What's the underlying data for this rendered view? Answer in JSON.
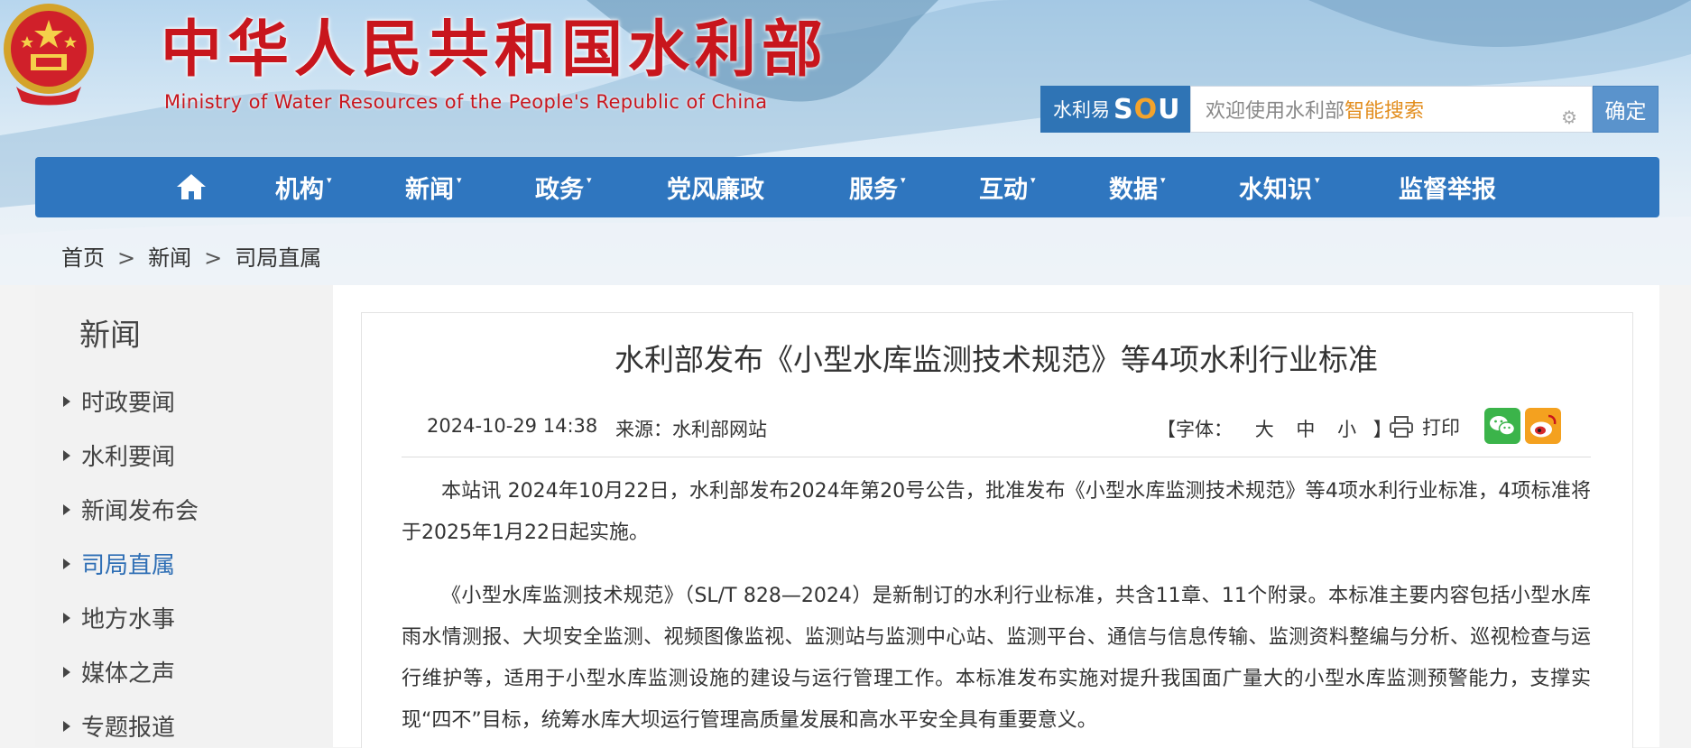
{
  "header": {
    "site_title": "中华人民共和国水利部",
    "site_subtitle": "Ministry of Water Resources of the People's Republic of China"
  },
  "search": {
    "brand_prefix": "水利易",
    "brand_s": "S",
    "brand_o": "O",
    "brand_u": "U",
    "placeholder_main": "欢迎使用水利部",
    "placeholder_highlight": "智能搜索",
    "submit_label": "确定"
  },
  "nav": {
    "items": [
      {
        "label": "机构",
        "dropdown": true
      },
      {
        "label": "新闻",
        "dropdown": true
      },
      {
        "label": "政务",
        "dropdown": true
      },
      {
        "label": "党风廉政",
        "dropdown": false
      },
      {
        "label": "服务",
        "dropdown": true
      },
      {
        "label": "互动",
        "dropdown": true
      },
      {
        "label": "数据",
        "dropdown": true
      },
      {
        "label": "水知识",
        "dropdown": true
      },
      {
        "label": "监督举报",
        "dropdown": false
      }
    ],
    "caret": "▾"
  },
  "breadcrumb": {
    "items": [
      "首页",
      "新闻",
      "司局直属"
    ],
    "separator": ">"
  },
  "sidebar": {
    "title": "新闻",
    "items": [
      {
        "label": "时政要闻",
        "active": false
      },
      {
        "label": "水利要闻",
        "active": false
      },
      {
        "label": "新闻发布会",
        "active": false
      },
      {
        "label": "司局直属",
        "active": true
      },
      {
        "label": "地方水事",
        "active": false
      },
      {
        "label": "媒体之声",
        "active": false
      },
      {
        "label": "专题报道",
        "active": false
      }
    ]
  },
  "article": {
    "title": "水利部发布《小型水库监测技术规范》等4项水利行业标准",
    "date": "2024-10-29 14:38",
    "source": "来源：水利部网站",
    "font_ctrl_open": "【字体：",
    "font_large": "大",
    "font_medium": "中",
    "font_small": "小",
    "font_ctrl_close": "】",
    "print_label": "打印",
    "paragraphs": [
      "本站讯 2024年10月22日，水利部发布2024年第20号公告，批准发布《小型水库监测技术规范》等4项水利行业标准，4项标准将于2025年1月22日起实施。",
      "《小型水库监测技术规范》（SL/T 828—2024）是新制订的水利行业标准，共含11章、11个附录。本标准主要内容包括小型水库雨水情测报、大坝安全监测、视频图像监视、监测站与监测中心站、监测平台、通信与信息传输、监测资料整编与分析、巡视检查与运行维护等，适用于小型水库监测设施的建设与运行管理工作。本标准发布实施对提升我国面广量大的小型水库监测预警能力，支撑实现“四不”目标，统筹水库大坝运行管理高质量发展和高水平安全具有重要意义。"
    ]
  },
  "colors": {
    "brand_red": "#c8161d",
    "nav_blue": "#2f76bf",
    "active_link": "#2f6fb5",
    "search_highlight": "#e28d1d"
  },
  "icons": [
    "national-emblem-icon",
    "home-icon",
    "gear-icon",
    "printer-icon",
    "wechat-icon",
    "weibo-icon"
  ]
}
